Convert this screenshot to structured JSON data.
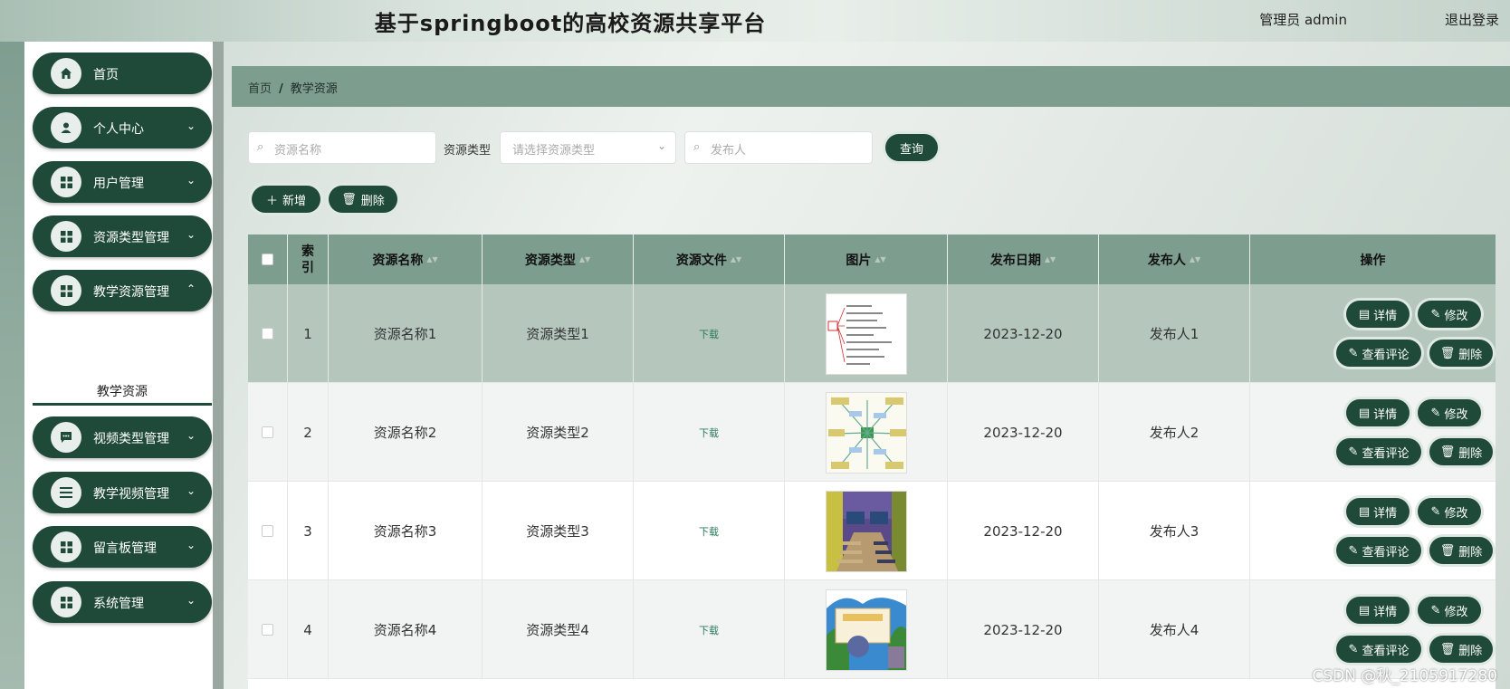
{
  "header": {
    "title": "基于springboot的高校资源共享平台",
    "user": "管理员 admin",
    "logout": "退出登录"
  },
  "sidebar": {
    "items": [
      {
        "label": "首页",
        "icon": "home-icon"
      },
      {
        "label": "个人中心",
        "icon": "user-icon"
      },
      {
        "label": "用户管理",
        "icon": "grid-icon"
      },
      {
        "label": "资源类型管理",
        "icon": "grid-icon"
      },
      {
        "label": "教学资源管理",
        "icon": "grid-icon"
      },
      {
        "label": "视频类型管理",
        "icon": "chat-icon"
      },
      {
        "label": "教学视频管理",
        "icon": "list-icon"
      },
      {
        "label": "留言板管理",
        "icon": "grid-icon"
      },
      {
        "label": "系统管理",
        "icon": "grid-icon"
      }
    ],
    "submenu_active": "教学资源"
  },
  "breadcrumb": {
    "home": "首页",
    "current": "教学资源"
  },
  "filters": {
    "name_placeholder": "资源名称",
    "type_label": "资源类型",
    "type_placeholder": "请选择资源类型",
    "publisher_placeholder": "发布人",
    "query": "查询"
  },
  "actions": {
    "add": "新增",
    "delete": "删除"
  },
  "table": {
    "headers": [
      "索引",
      "资源名称",
      "资源类型",
      "资源文件",
      "图片",
      "发布日期",
      "发布人",
      "操作"
    ],
    "rows": [
      {
        "index": "1",
        "name": "资源名称1",
        "type": "资源类型1",
        "file": "下载",
        "date": "2023-12-20",
        "publisher": "发布人1"
      },
      {
        "index": "2",
        "name": "资源名称2",
        "type": "资源类型2",
        "file": "下载",
        "date": "2023-12-20",
        "publisher": "发布人2"
      },
      {
        "index": "3",
        "name": "资源名称3",
        "type": "资源类型3",
        "file": "下载",
        "date": "2023-12-20",
        "publisher": "发布人3"
      },
      {
        "index": "4",
        "name": "资源名称4",
        "type": "资源类型4",
        "file": "下载",
        "date": "2023-12-20",
        "publisher": "发布人4"
      }
    ],
    "op_labels": {
      "detail": "详情",
      "edit": "修改",
      "comments": "查看评论",
      "delete": "删除"
    }
  },
  "watermark": "CSDN @秋_2105917280",
  "colors": {
    "primary": "#1f4a3a",
    "header_row": "#7d9d8f",
    "selected_row": "#b5c7bd"
  }
}
